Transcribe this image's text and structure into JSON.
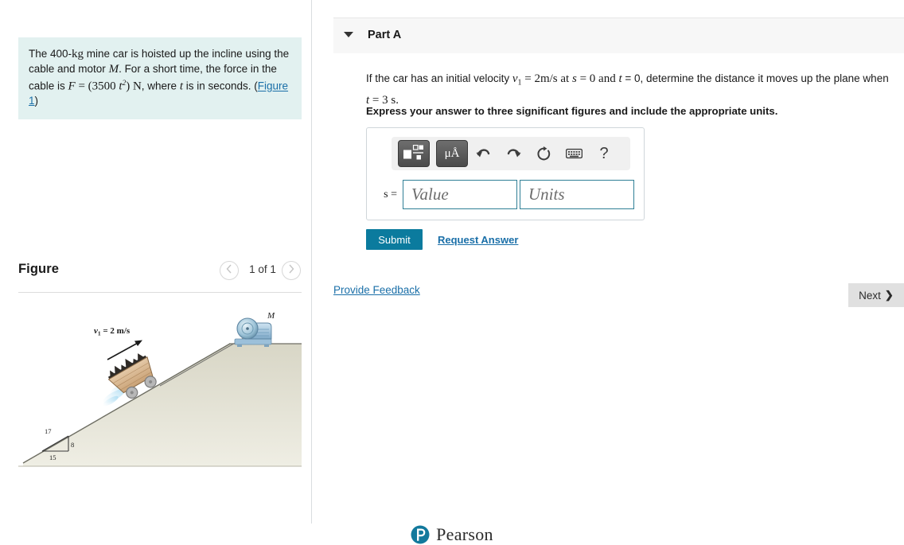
{
  "problem": {
    "text_part1": "The 400-",
    "mass_unit": "kg",
    "text_part2": " mine car is hoisted up the incline using the cable and motor ",
    "motor_symbol": "M",
    "text_part3": ". For a short time, the force in the cable is ",
    "force_symbol": "F",
    "force_eq": " = (3500 ",
    "time_symbol": "t",
    "force_exp": "2",
    "force_close": ") ",
    "force_unit": "N",
    "text_part4": ", where ",
    "time_symbol2": "t",
    "text_part5": " is in seconds. (",
    "figure_link": "Figure 1",
    "text_part6": ")"
  },
  "figure": {
    "title": "Figure",
    "pager_label": "1 of 1",
    "prev_icon": "chevron-left-icon",
    "next_icon": "chevron-right-icon",
    "diagram": {
      "velocity_label": "v",
      "velocity_sub": "1",
      "velocity_value": " = 2 m/s",
      "motor_label": "M",
      "triangle_hyp": "17",
      "triangle_vert": "8",
      "triangle_horiz": "15"
    }
  },
  "part_a": {
    "title": "Part A",
    "caret_icon": "caret-down-icon",
    "question": {
      "p1": "If the car has an initial velocity ",
      "v_symbol": "v",
      "v_sub": "1",
      "p2": " = 2m/s at ",
      "s_symbol": "s",
      "p3": " = 0 and ",
      "t_symbol": "t",
      "p4": " = 0, determine the distance it moves up the plane when ",
      "t_symbol2": "t",
      "p5": " = 3 s."
    },
    "instruction": "Express your answer to three significant figures and include the appropriate units.",
    "answer": {
      "label": "s =",
      "value": "",
      "value_placeholder": "Value",
      "units": "",
      "units_placeholder": "Units"
    },
    "toolbar": {
      "template_icon": "math-template-icon",
      "units_icon": "micro-angstrom-icon",
      "units_label": "μÅ",
      "undo_icon": "undo-icon",
      "redo_icon": "redo-icon",
      "reset_icon": "reset-icon",
      "keyboard_icon": "keyboard-icon",
      "help_icon": "help-icon",
      "help_label": "?"
    },
    "submit_label": "Submit",
    "request_answer_label": "Request Answer"
  },
  "footer_nav": {
    "provide_feedback_label": "Provide Feedback",
    "next_label": "Next",
    "next_chevron": "❯"
  },
  "brand": {
    "name": "Pearson",
    "logo_letter": "P",
    "logo_icon": "pearson-logo-icon"
  },
  "colors": {
    "accent_teal": "#0b7b9e",
    "link_blue": "#1a6fa8",
    "problem_bg": "#e2f1f0",
    "header_bg": "#f7f7f7",
    "input_border": "#2f7f96",
    "pearson_teal": "#12799c"
  }
}
